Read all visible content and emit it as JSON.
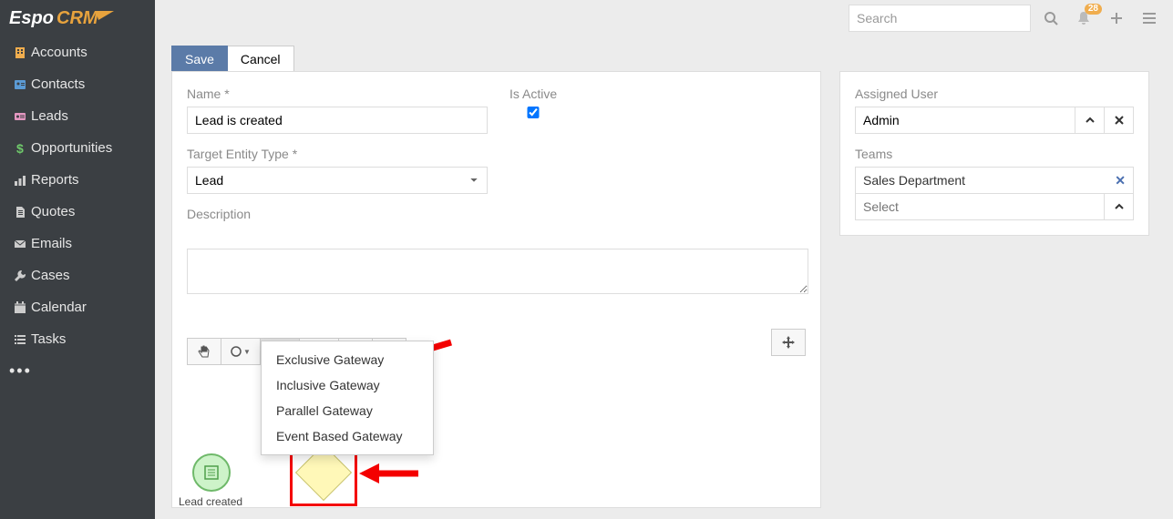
{
  "logo_text": "EspoCRM",
  "sidebar": {
    "items": [
      {
        "icon": "building",
        "color": "#f0ad4e",
        "label": "Accounts"
      },
      {
        "icon": "id-card",
        "color": "#5b9bd5",
        "label": "Contacts"
      },
      {
        "icon": "badge",
        "color": "#e497c1",
        "label": "Leads"
      },
      {
        "icon": "dollar",
        "color": "#6fc96b",
        "label": "Opportunities"
      },
      {
        "icon": "chart",
        "color": "#ccc",
        "label": "Reports"
      },
      {
        "icon": "file",
        "color": "#ccc",
        "label": "Quotes"
      },
      {
        "icon": "envelope",
        "color": "#ccc",
        "label": "Emails"
      },
      {
        "icon": "wrench",
        "color": "#ccc",
        "label": "Cases"
      },
      {
        "icon": "calendar",
        "color": "#ccc",
        "label": "Calendar"
      },
      {
        "icon": "tasks",
        "color": "#ccc",
        "label": "Tasks"
      }
    ]
  },
  "topbar": {
    "search_placeholder": "Search",
    "notification_count": "28"
  },
  "actions": {
    "save": "Save",
    "cancel": "Cancel"
  },
  "form": {
    "name_label": "Name *",
    "name_value": "Lead is created",
    "is_active_label": "Is Active",
    "is_active_checked": true,
    "target_entity_label": "Target Entity Type *",
    "target_entity_value": "Lead",
    "description_label": "Description",
    "description_value": ""
  },
  "bpmn_toolbar": {
    "tools": [
      "hand",
      "event",
      "gateway",
      "activity",
      "flow",
      "erase"
    ]
  },
  "gateway_menu": {
    "items": [
      "Exclusive Gateway",
      "Inclusive Gateway",
      "Parallel Gateway",
      "Event Based Gateway"
    ]
  },
  "bpmn": {
    "event_label": "Lead created"
  },
  "side": {
    "assigned_user_label": "Assigned User",
    "assigned_user_value": "Admin",
    "teams_label": "Teams",
    "team_chip": "Sales Department",
    "team_select_placeholder": "Select"
  }
}
